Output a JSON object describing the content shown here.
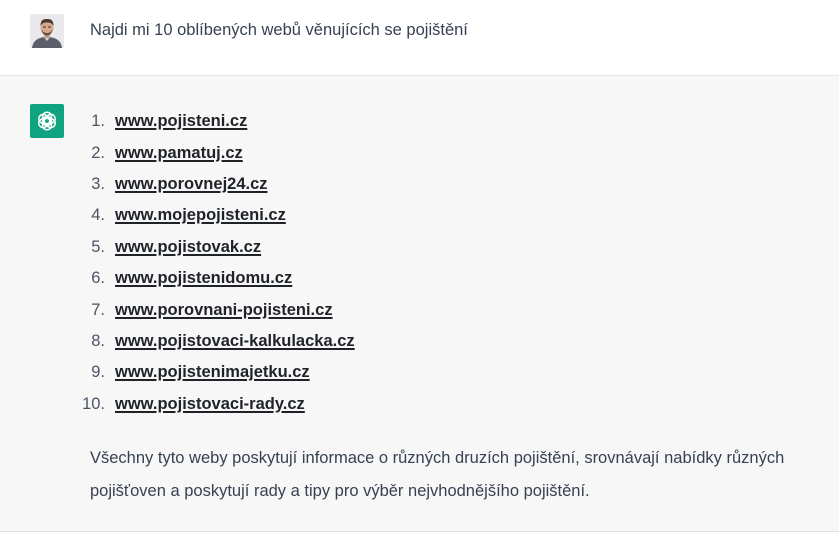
{
  "user_message": {
    "text": "Najdi mi 10 oblíbených webů věnujících se pojištění",
    "avatar": "user-avatar-photo"
  },
  "assistant_message": {
    "avatar_icon": "openai-logo-icon",
    "accent_color": "#10a37f",
    "items": [
      {
        "num": "1.",
        "link": "www.pojisteni.cz"
      },
      {
        "num": "2.",
        "link": "www.pamatuj.cz"
      },
      {
        "num": "3.",
        "link": "www.porovnej24.cz"
      },
      {
        "num": "4.",
        "link": "www.mojepojisteni.cz"
      },
      {
        "num": "5.",
        "link": "www.pojistovak.cz"
      },
      {
        "num": "6.",
        "link": "www.pojistenidomu.cz"
      },
      {
        "num": "7.",
        "link": "www.porovnani-pojisteni.cz"
      },
      {
        "num": "8.",
        "link": "www.pojistovaci-kalkulacka.cz"
      },
      {
        "num": "9.",
        "link": "www.pojistenimajetku.cz"
      },
      {
        "num": "10.",
        "link": "www.pojistovaci-rady.cz"
      }
    ],
    "summary": "Všechny tyto weby poskytují informace o různých druzích pojištění, srovnávají nabídky různých pojišťoven a poskytují rady a tipy pro výběr nejvhodnějšího pojištění."
  }
}
